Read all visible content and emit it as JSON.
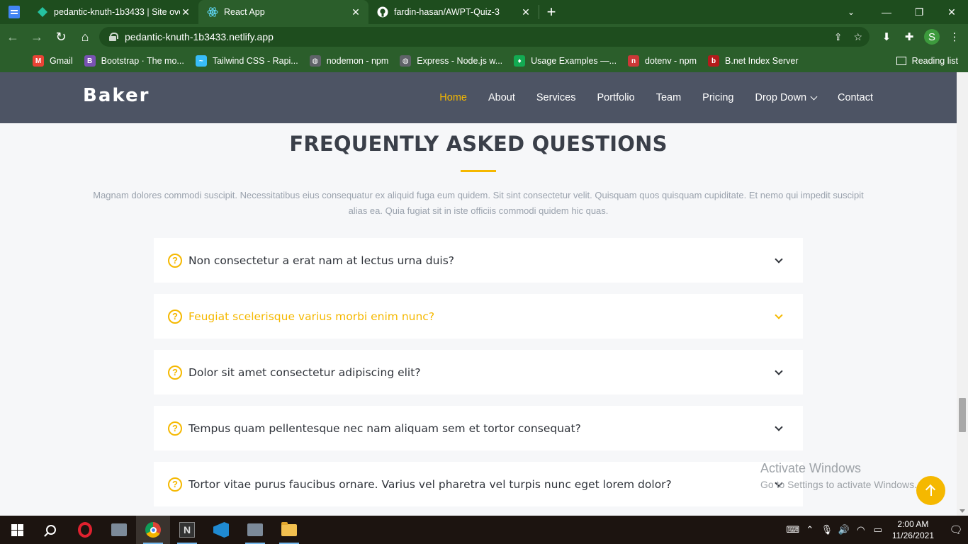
{
  "browser": {
    "tabs": [
      {
        "title": "pedantic-knuth-1b3433 | Site ove",
        "active": false
      },
      {
        "title": "React App",
        "active": true
      },
      {
        "title": "fardin-hasan/AWPT-Quiz-3",
        "active": false
      }
    ],
    "new_tab": "+",
    "address": "pedantic-knuth-1b3433.netlify.app",
    "profile_initial": "S",
    "bookmarks": [
      {
        "label": "Gmail",
        "icon": "gmail-icon",
        "color": "#ea4335",
        "glyph": "M"
      },
      {
        "label": "Bootstrap · The mo...",
        "icon": "bootstrap-icon",
        "color": "#7952b3",
        "glyph": "B"
      },
      {
        "label": "Tailwind CSS - Rapi...",
        "icon": "tailwind-icon",
        "color": "#38bdf8",
        "glyph": "~"
      },
      {
        "label": "nodemon - npm",
        "icon": "globe-icon",
        "color": "#5f6368",
        "glyph": "◍"
      },
      {
        "label": "Express - Node.js w...",
        "icon": "globe-icon",
        "color": "#5f6368",
        "glyph": "◍"
      },
      {
        "label": "Usage Examples —...",
        "icon": "mongodb-leaf-icon",
        "color": "#13aa52",
        "glyph": "♦"
      },
      {
        "label": "dotenv - npm",
        "icon": "npm-icon",
        "color": "#cb3837",
        "glyph": "n"
      },
      {
        "label": "B.net Index Server",
        "icon": "bnet-icon",
        "color": "#b31b1b",
        "glyph": "b"
      }
    ],
    "reading_list": "Reading list"
  },
  "site": {
    "logo": "Baker",
    "nav": [
      {
        "label": "Home",
        "active": true,
        "dropdown": false
      },
      {
        "label": "About",
        "active": false,
        "dropdown": false
      },
      {
        "label": "Services",
        "active": false,
        "dropdown": false
      },
      {
        "label": "Portfolio",
        "active": false,
        "dropdown": false
      },
      {
        "label": "Team",
        "active": false,
        "dropdown": false
      },
      {
        "label": "Pricing",
        "active": false,
        "dropdown": false
      },
      {
        "label": "Drop Down",
        "active": false,
        "dropdown": true
      },
      {
        "label": "Contact",
        "active": false,
        "dropdown": false
      }
    ],
    "accent_color": "#f5b800"
  },
  "faq": {
    "title": "FREQUENTLY ASKED QUESTIONS",
    "description": "Magnam dolores commodi suscipit. Necessitatibus eius consequatur ex aliquid fuga eum quidem. Sit sint consectetur velit. Quisquam quos quisquam cupiditate. Et nemo qui impedit suscipit alias ea. Quia fugiat sit in iste officiis commodi quidem hic quas.",
    "items": [
      {
        "question": "Non consectetur a erat nam at lectus urna duis?",
        "open": false
      },
      {
        "question": "Feugiat scelerisque varius morbi enim nunc?",
        "open": true
      },
      {
        "question": "Dolor sit amet consectetur adipiscing elit?",
        "open": false
      },
      {
        "question": "Tempus quam pellentesque nec nam aliquam sem et tortor consequat?",
        "open": false
      },
      {
        "question": "Tortor vitae purus faucibus ornare. Varius vel pharetra vel turpis nunc eget lorem dolor?",
        "open": false
      }
    ]
  },
  "watermark": {
    "line1": "Activate Windows",
    "line2": "Go to Settings to activate Windows."
  },
  "taskbar": {
    "time": "2:00 AM",
    "date": "11/26/2021"
  }
}
